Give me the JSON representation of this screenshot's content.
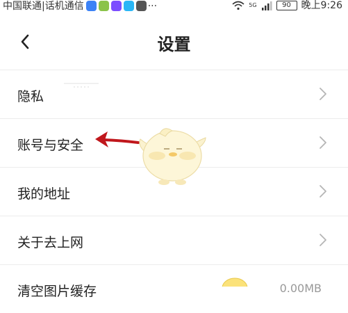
{
  "status_bar": {
    "carrier": "中国联通|话机通信",
    "more": "···",
    "signal_label": "5G",
    "battery": "90",
    "time": "晚上9:26"
  },
  "header": {
    "title": "设置"
  },
  "settings": {
    "items": [
      {
        "label": "隐私"
      },
      {
        "label": "账号与安全"
      },
      {
        "label": "我的地址"
      },
      {
        "label": "关于去上网"
      },
      {
        "label": "清空图片缓存",
        "value": "0.00MB"
      }
    ]
  },
  "colors": {
    "annotation_arrow": "#c0171c",
    "divider": "#ececec",
    "chevron": "#b5b5b5"
  }
}
